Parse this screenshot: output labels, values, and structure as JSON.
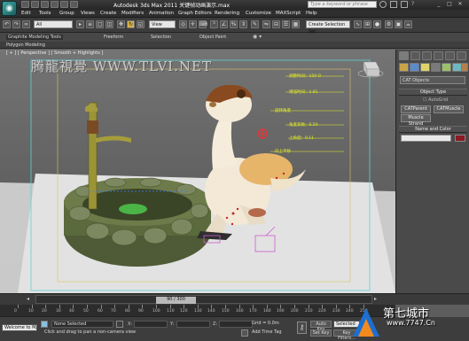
{
  "app": {
    "title": "Autodesk 3ds Max  2011    关键帧动画演示.max",
    "icon_glyph": "◉",
    "search_placeholder": "Type a keyword or phrase"
  },
  "window_controls": [
    "_",
    "□",
    "✕"
  ],
  "menu": [
    "Edit",
    "Tools",
    "Group",
    "Views",
    "Create",
    "Modifiers",
    "Animation",
    "Graph Editors",
    "Rendering",
    "Customize",
    "MAXScript",
    "Help"
  ],
  "toolbar": {
    "selection_filter": "All",
    "ref_coord": "View",
    "named_selection": "Create Selection Set"
  },
  "ribbon": {
    "tabs": [
      "Graphite Modeling Tools",
      "Freeform",
      "Selection",
      "Object Paint"
    ],
    "subtab": "Polygon Modeling"
  },
  "viewport": {
    "label": "[ + ] [ Perspective ] [ Smooth + Highlights ]",
    "watermark": "腾龍視覺 WWW.TLVI.NET",
    "annotations": [
      "调整时间：150 O",
      "增强时间：1.81",
      "旋转角度",
      "角度系数：0.50",
      "上角度：0.11",
      "向上平移"
    ]
  },
  "command_panel": {
    "category": "CAT Objects",
    "rollout_object_type": "Object Type",
    "autogrid": "AutoGrid",
    "buttons": [
      "CATParent",
      "CATMuscle",
      "Muscle Strand"
    ],
    "rollout_name_color": "Name and Color",
    "accent_color": "#8b1a22"
  },
  "timeline": {
    "frame_display": "90 / 300",
    "ticks": [
      "0",
      "10",
      "20",
      "30",
      "40",
      "50",
      "60",
      "70",
      "80",
      "90",
      "100",
      "110",
      "120",
      "130",
      "140",
      "150",
      "160",
      "170",
      "180",
      "190",
      "200",
      "210",
      "220",
      "230",
      "240",
      "250"
    ]
  },
  "status": {
    "welcome": "Welcome to MAX",
    "selection": "None Selected",
    "prompt": "Click and drag to pan a non-camera view",
    "x_label": "X:",
    "y_label": "Y:",
    "z_label": "Z:",
    "grid": "Grid = 0.0m",
    "add_time_tag": "Add Time Tag",
    "auto_key": "Auto Key",
    "set_key": "Set Key",
    "key_filters": "Key Filters...",
    "key_mode": "Selected"
  },
  "site_logo": {
    "name": "第七城市",
    "url": "www.7747.Cn"
  }
}
